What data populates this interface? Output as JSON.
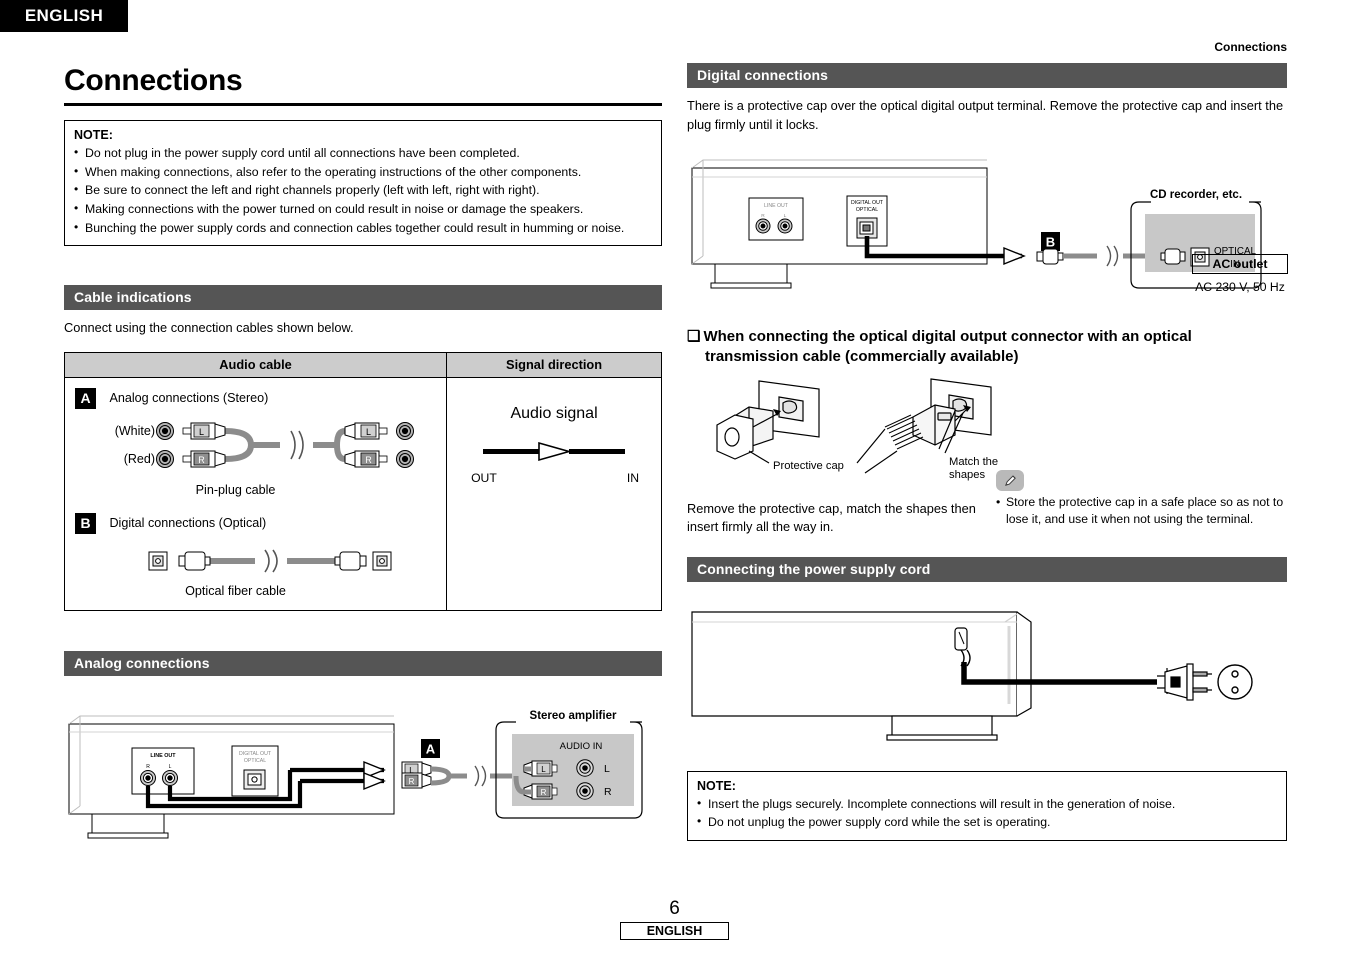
{
  "language_tab": "ENGLISH",
  "running_head": "Connections",
  "page_title": "Connections",
  "top_note": {
    "title": "NOTE:",
    "items": [
      "Do not plug in the power supply cord until all connections have been completed.",
      "When making connections, also refer to the operating instructions of the other components.",
      "Be sure to connect the left and right channels properly (left with left, right with right).",
      "Making connections with the power turned on could result in noise or damage the speakers.",
      "Bunching the power supply cords and connection cables together could result in humming or noise."
    ]
  },
  "cable_indications": {
    "heading": "Cable indications",
    "intro": "Connect using the connection cables shown below.",
    "table": {
      "headers": [
        "Audio cable",
        "Signal direction"
      ],
      "rows": [
        {
          "marker": "A",
          "label": "Analog connections (Stereo)",
          "caption": "Pin-plug cable",
          "plug_white": "(White)",
          "plug_red": "(Red)",
          "plug_left": "L",
          "plug_right": "R"
        },
        {
          "marker": "B",
          "label": "Digital connections (Optical)",
          "caption": "Optical fiber cable"
        }
      ],
      "direction": {
        "title": "Audio signal",
        "out": "OUT",
        "in": "IN"
      }
    }
  },
  "analog_connections": {
    "heading": "Analog connections",
    "marker": "A",
    "device_labels": {
      "line_out": "LINE OUT",
      "line_out_r": "R",
      "line_out_l": "L",
      "digital_out": "DIGITAL OUT",
      "optical": "OPTICAL"
    },
    "amplifier": {
      "title": "Stereo amplifier",
      "input_label": "AUDIO IN",
      "jack_l": "L",
      "jack_r": "R",
      "plug_l": "L",
      "plug_r": "R"
    }
  },
  "digital_connections": {
    "heading": "Digital connections",
    "intro": "There is a protective cap over the optical digital output terminal. Remove the protective cap and insert the plug firmly until it locks.",
    "marker": "B",
    "device_labels": {
      "line_out": "LINE OUT",
      "line_out_r": "R",
      "line_out_l": "L",
      "digital_out": "DIGITAL OUT",
      "optical": "OPTICAL"
    },
    "recorder": {
      "title": "CD recorder, etc.",
      "input_label_line1": "OPTICAL",
      "input_label_line2": "IN"
    }
  },
  "optical_cable_section": {
    "heading_line1": "When connecting the optical digital output connector with an optical",
    "heading_line2": "transmission cable (commercially available)",
    "label_protective_cap": "Protective cap",
    "label_match_line1": "Match the",
    "label_match_line2": "shapes",
    "instruction": "Remove the protective cap, match the shapes then insert firmly all the way in.",
    "memo": "Store the protective cap in a safe place so as not to lose it, and use it when not using the terminal."
  },
  "power_cord_section": {
    "heading": "Connecting the power supply cord",
    "ac_outlet_label": "AC outlet",
    "ac_rating": "AC 230 V,  50 Hz",
    "note": {
      "title": "NOTE:",
      "items": [
        "Insert the plugs securely. Incomplete connections will result in the generation of noise.",
        "Do not unplug the power supply cord while the set is operating."
      ]
    }
  },
  "footer": {
    "page_number": "6",
    "language": "ENGLISH"
  },
  "colors": {
    "section_bar": "#555555",
    "table_header": "#cccccc",
    "panel_fill": "#c8c8c8",
    "cable_grey": "#8c8c8c",
    "marker_bg": "#000000"
  }
}
